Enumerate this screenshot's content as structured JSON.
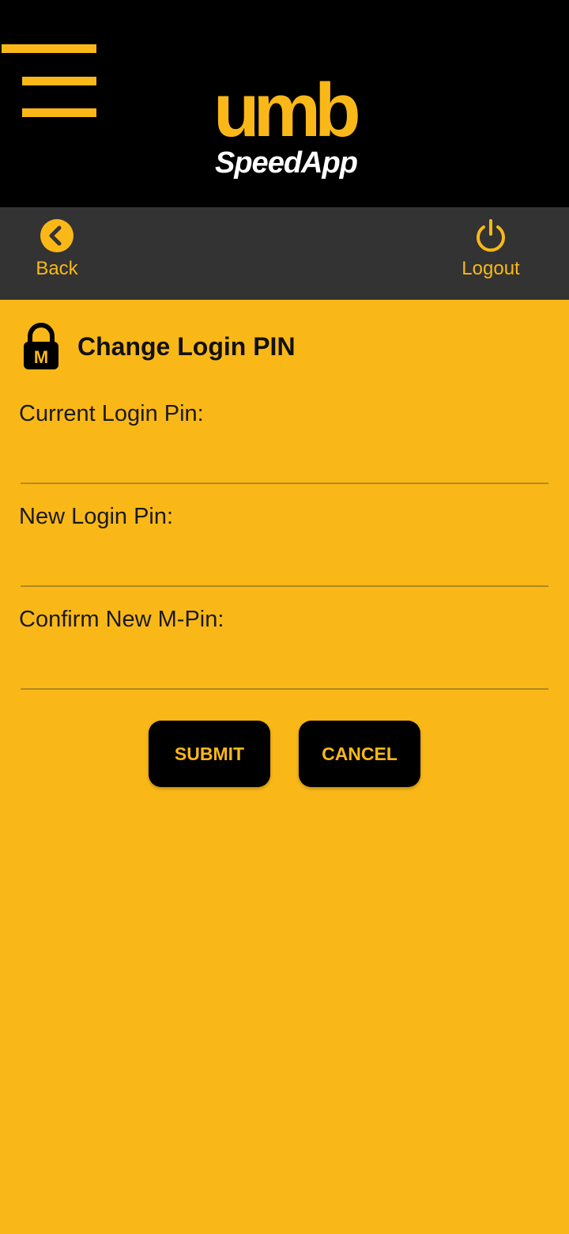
{
  "header": {
    "logo_mark": "umb",
    "logo_text": "SpeedApp",
    "menu_icon": "hamburger-menu-icon"
  },
  "nav": {
    "back_label": "Back",
    "back_icon": "chevron-left-circle-icon",
    "logout_label": "Logout",
    "logout_icon": "power-icon"
  },
  "page": {
    "title": "Change Login PIN",
    "title_icon": "m-lock-icon",
    "lock_letter": "M"
  },
  "form": {
    "fields": [
      {
        "label": "Current Login Pin:",
        "value": "",
        "placeholder": ""
      },
      {
        "label": "New Login Pin:",
        "value": "",
        "placeholder": ""
      },
      {
        "label": "Confirm New M-Pin:",
        "value": "",
        "placeholder": ""
      }
    ],
    "submit_label": "SUBMIT",
    "cancel_label": "CANCEL"
  },
  "colors": {
    "background": "#FAB818",
    "header": "#000000",
    "subbar": "#333333",
    "accent": "#FAB818",
    "button": "#000000"
  }
}
